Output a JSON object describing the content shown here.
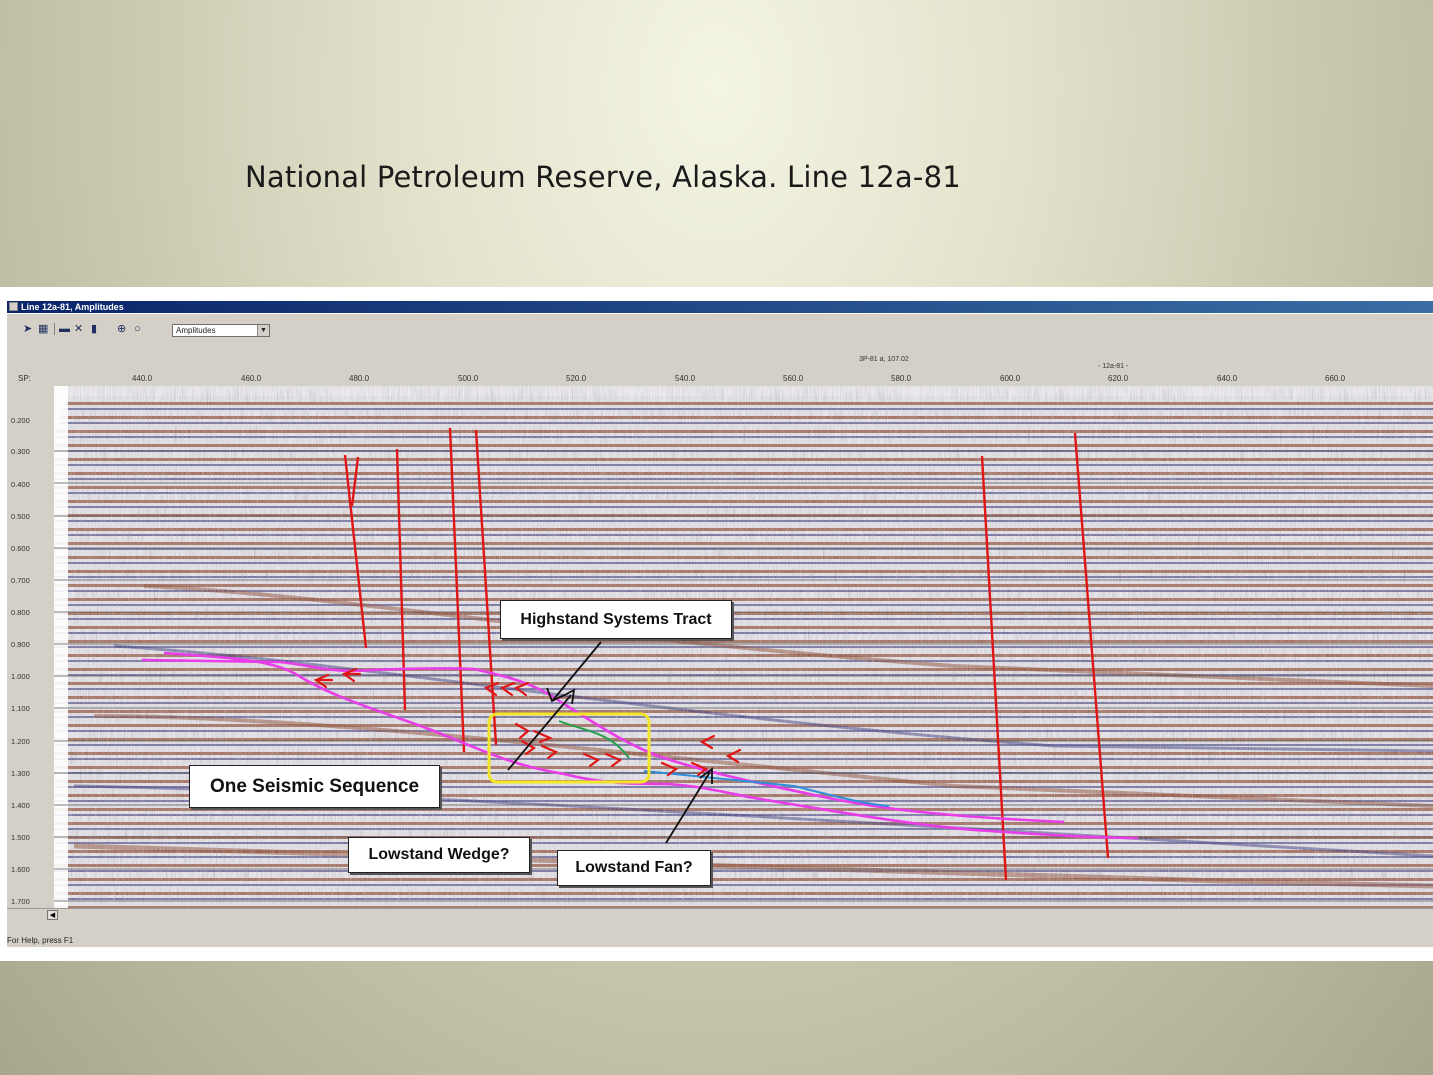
{
  "slide": {
    "title": "National Petroleum Reserve, Alaska.  Line 12a-81"
  },
  "window": {
    "title": "Line 12a-81, Amplitudes",
    "status": "For Help, press F1",
    "scroll_arrow": "◀"
  },
  "toolbar": {
    "icons": [
      "pointer-icon",
      "hatch-icon",
      "line-tool-icon",
      "crossed-tool-icon",
      "marker-icon",
      "zoom-in-icon",
      "zoom-out-icon"
    ],
    "display_select": "Amplitudes"
  },
  "axis": {
    "sp_label": "SP:",
    "sp_ticks": [
      "440.0",
      "460.0",
      "480.0",
      "500.0",
      "520.0",
      "540.0",
      "560.0",
      "580.0",
      "600.0",
      "620.0",
      "640.0",
      "660.0"
    ],
    "tie_marks": [
      {
        "label": "3P-81 a, 107.02",
        "at": "580.0"
      },
      {
        "label": "- 12a-81 -",
        "at": "620.0"
      }
    ],
    "time_ticks": [
      "0.200",
      "0.300",
      "0.400",
      "0.500",
      "0.600",
      "0.700",
      "0.800",
      "0.900",
      "1.000",
      "1.100",
      "1.200",
      "1.300",
      "1.400",
      "1.500",
      "1.600",
      "1.700"
    ]
  },
  "annotations": {
    "highstand": "Highstand Systems Tract",
    "sequence": "One Seismic Sequence",
    "lowstand_wedge": "Lowstand Wedge?",
    "lowstand_fan": "Lowstand Fan?"
  },
  "colors": {
    "fault": "#e01515",
    "sequence_boundary": "#e83de8",
    "highlight_box": "#f2e52a",
    "wedge_horizon": "#23a04a",
    "fan_horizon": "#2f8fd8"
  }
}
